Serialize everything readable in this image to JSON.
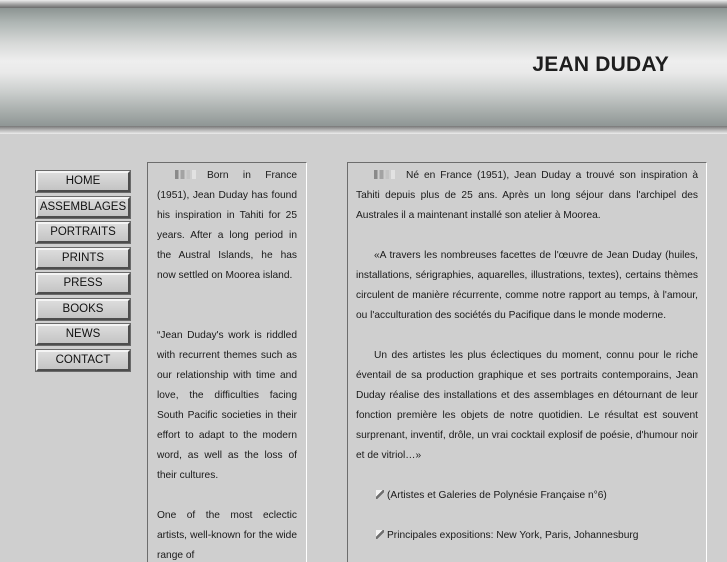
{
  "header": {
    "title": "JEAN DUDAY"
  },
  "nav": {
    "items": [
      {
        "label": "HOME"
      },
      {
        "label": "ASSEMBLAGES"
      },
      {
        "label": "PORTRAITS"
      },
      {
        "label": "PRINTS"
      },
      {
        "label": "PRESS"
      },
      {
        "label": "BOOKS"
      },
      {
        "label": "NEWS"
      },
      {
        "label": "CONTACT"
      }
    ]
  },
  "english": {
    "p1": "Born in France (1951), Jean Duday has found his inspiration in Tahiti for 25 years. After a long period in the Austral Islands, he has now settled on Moorea island.",
    "p2": "“Jean Duday's work is riddled with recurrent themes such as our relationship with time and love, the difficulties facing South Pacific societies in their effort to adapt to the modern word, as well as the loss of their cultures.",
    "p3": "One of the most eclectic artists, well-known for the wide range of"
  },
  "french": {
    "p1": "Né en France (1951), Jean Duday a trouvé son inspiration à Tahiti depuis plus de 25 ans. Après un long séjour dans l'archipel des Australes il a maintenant installé son atelier à Moorea.",
    "p2": "«A travers les nombreuses facettes de l'œuvre de Jean Duday (huiles, installations, sérigraphies, aquarelles, illustrations, textes), certains thèmes circulent de manière récurrente, comme notre rapport au temps, à l'amour, ou l'acculturation des sociétés du Pacifique dans le monde moderne.",
    "p3": "Un des artistes les plus éclectiques du moment, connu pour le riche éventail de sa production graphique et ses portraits contemporains, Jean Duday réalise des installations et des assemblages en détournant de leur fonction première les objets de notre quotidien. Le résultat est souvent surprenant, inventif, drôle, un vrai cocktail explosif de poésie, d'humour noir et de vitriol…»",
    "source": "(Artistes et Galeries de Polynésie Française n°6)",
    "expos": "Principales expositions: New York, Paris, Johannesburg"
  }
}
